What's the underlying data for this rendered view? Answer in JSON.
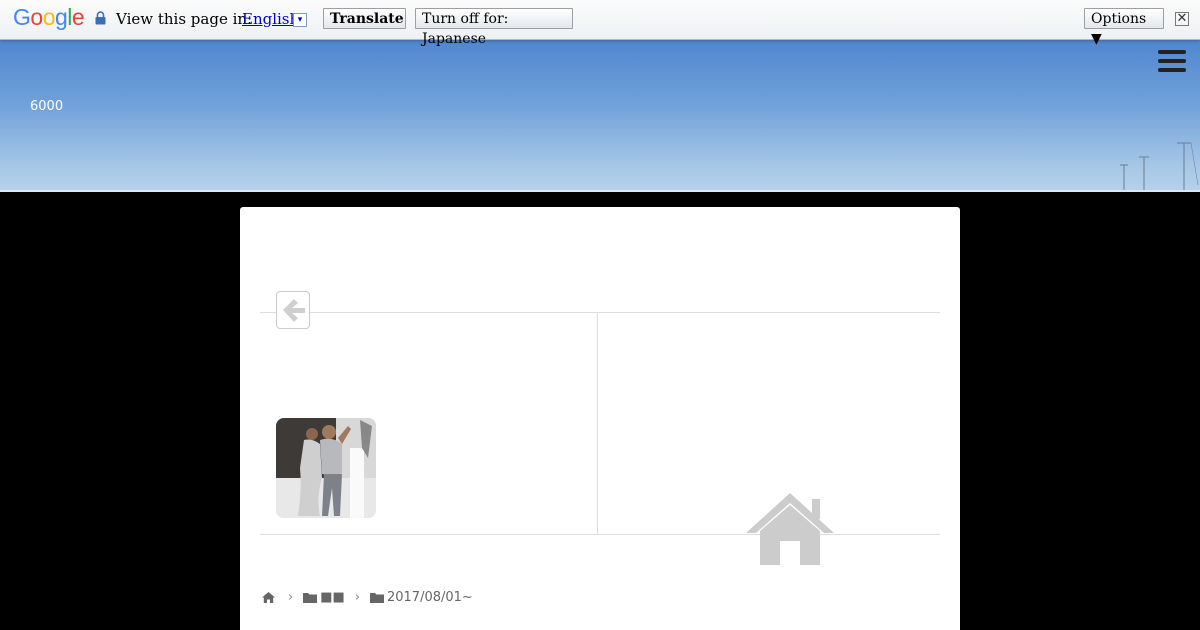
{
  "translate_bar": {
    "logo_text": [
      "G",
      "o",
      "o",
      "g",
      "l",
      "e"
    ],
    "view_text": "View this page in:",
    "language": "English",
    "language_dropdown": "▾",
    "translate_label": "Translate",
    "turn_off_label": "Turn off for: Japanese",
    "options_label": "Options ▼",
    "close_label": "✕"
  },
  "header": {
    "site_title": "6000"
  },
  "breadcrumb": {
    "category": "■■",
    "subcategory": "2017/08/01~"
  },
  "colors": {
    "translate_link": "#0000cc",
    "page_background": "#000000",
    "card_background": "#ffffff",
    "muted_icon": "#cccccc"
  }
}
